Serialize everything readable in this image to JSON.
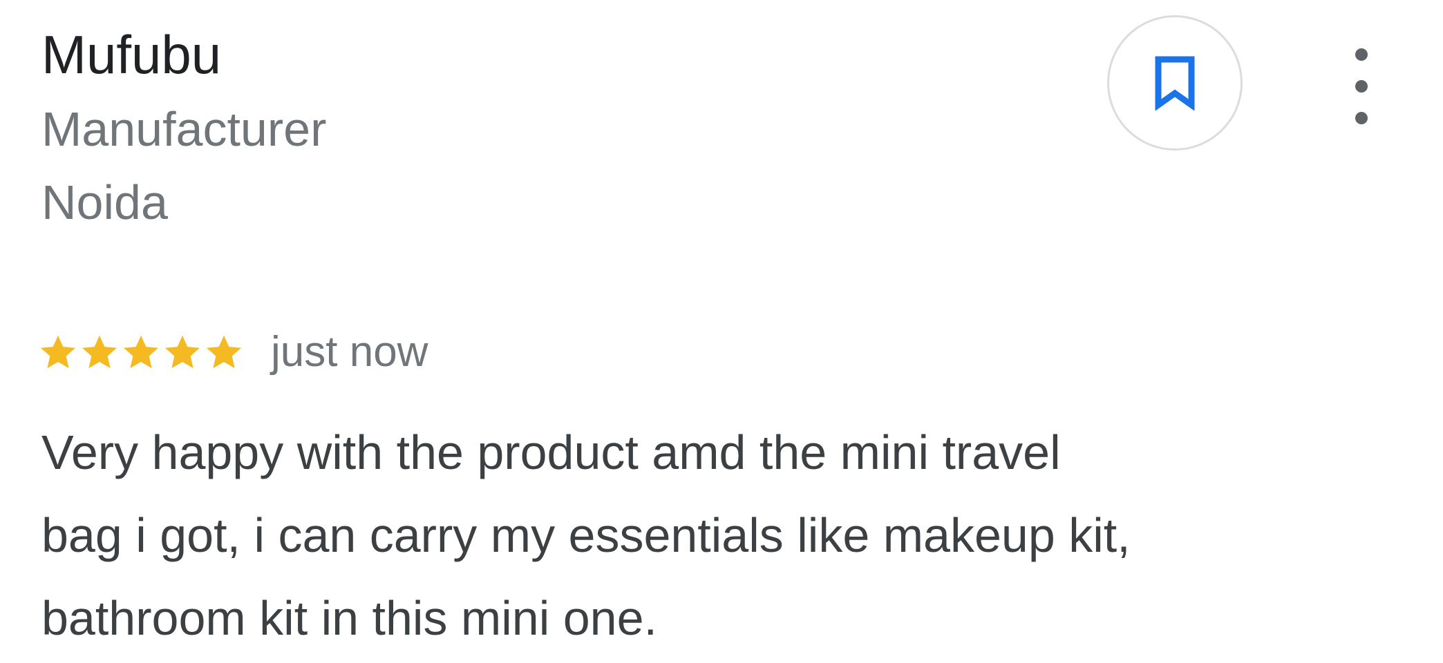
{
  "business": {
    "name": "Mufubu",
    "category": "Manufacturer",
    "location": "Noida"
  },
  "actions": {
    "save_icon": "bookmark-icon",
    "more_icon": "more-vert-icon"
  },
  "review": {
    "rating": 5,
    "rating_max": 5,
    "timestamp": "just now",
    "text_lines": [
      "Very happy with the product amd the mini travel",
      "bag i got, i can carry my essentials like makeup kit,",
      "bathroom kit in this mini one."
    ]
  },
  "colors": {
    "star": "#f5b921",
    "bookmark": "#1a73e8",
    "primary_text": "#202124",
    "secondary_text": "#70757a",
    "body_text": "#3c4043"
  }
}
